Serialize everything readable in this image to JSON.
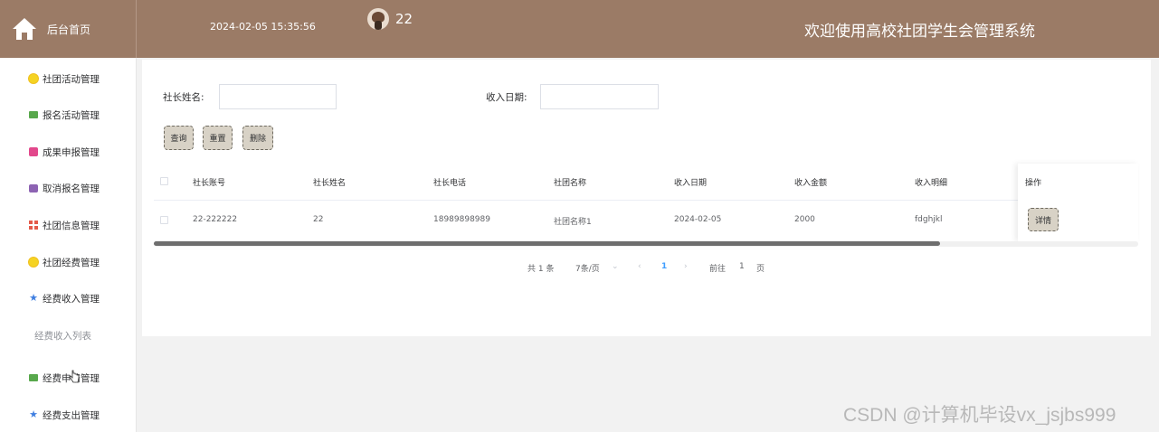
{
  "header": {
    "home_label": "后台首页",
    "datetime": "2024-02-05 15:35:56",
    "username": "22",
    "system_title": "欢迎使用高校社团学生会管理系统"
  },
  "sidebar": {
    "items": [
      {
        "label": "社团活动管理",
        "icon": "sun-icon"
      },
      {
        "label": "报名活动管理",
        "icon": "green-message-icon"
      },
      {
        "label": "成果申报管理",
        "icon": "pink-doc-icon"
      },
      {
        "label": "取消报名管理",
        "icon": "purple-box-icon"
      },
      {
        "label": "社团信息管理",
        "icon": "grid-icon"
      },
      {
        "label": "社团经费管理",
        "icon": "sun-icon"
      },
      {
        "label": "经费收入管理",
        "icon": "star-icon"
      },
      {
        "label": "经费收入列表",
        "icon": ""
      },
      {
        "label": "经费申请管理",
        "icon": "green-message-icon"
      },
      {
        "label": "经费支出管理",
        "icon": "star-icon"
      }
    ]
  },
  "search": {
    "president_name_label": "社长姓名:",
    "president_name_value": "",
    "income_date_label": "收入日期:",
    "income_date_value": ""
  },
  "buttons": {
    "query": "查询",
    "reset": "重置",
    "delete": "删除"
  },
  "table": {
    "columns": [
      "社长账号",
      "社长姓名",
      "社长电话",
      "社团名称",
      "收入日期",
      "收入金额",
      "收入明细",
      "操作"
    ],
    "rows": [
      {
        "account": "22-222222",
        "name": "22",
        "phone": "18989898989",
        "club": "社团名称1",
        "date": "2024-02-05",
        "amount": "2000",
        "detail": "fdghjkl",
        "action": "详情"
      }
    ]
  },
  "pagination": {
    "total": "共 1 条",
    "page_size": "7条/页",
    "prev": "‹",
    "current_page": "1",
    "next": "›",
    "goto_label": "前往",
    "goto_value": "1",
    "page_unit": "页"
  },
  "watermark": "CSDN @计算机毕设vx_jsjbs999",
  "colors": {
    "header_bg": "#9b7b66",
    "button_bg": "#d8d2c6"
  }
}
